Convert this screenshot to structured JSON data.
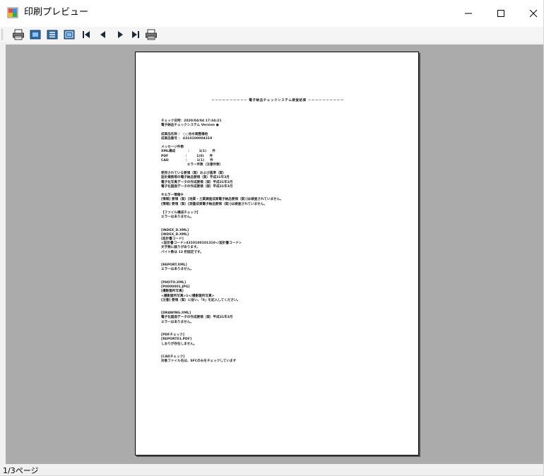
{
  "window": {
    "title": "印刷プレビュー"
  },
  "toolbar": {
    "buttons": [
      {
        "name": "print-icon"
      },
      {
        "name": "zoom-icon"
      },
      {
        "name": "one-page-icon"
      },
      {
        "name": "two-page-icon"
      },
      {
        "name": "first-page-icon"
      },
      {
        "name": "previous-page-icon"
      },
      {
        "name": "next-page-icon"
      },
      {
        "name": "last-page-icon"
      },
      {
        "name": "print-setup-icon"
      }
    ]
  },
  "document": {
    "title": "－－－－－－－－－－ 電子納品チェックシステム検査結果 －－－－－－－－－－",
    "lines": [
      "チェック日時：2020/04/04 17:34:21",
      "電子納品チェックシステム Version ●",
      "",
      "成果品名称 ： ○○谷水路整備他",
      "成果品番号 ： 4310100004310",
      "",
      "メッセージ件数",
      "XML構成           ：       1(1)     件",
      "PDF               ：       1(0)     件",
      "CAD               ：       1(1)     件",
      "                       エラー件数（注意件数）",
      "",
      "使用されている要領（案）および基準（案）",
      "設計業務等の電子納品要領（案）平成31年3月",
      "電子化写真データの作成要領（案）平成31年3月",
      "電子化図面データの作成要領（案）平成31年3月",
      "",
      "※エラー情報※",
      "[情報] 要領（案）[地質・土質調査成果電子納品要領（案）]は検査されていません。",
      "[情報] 要領（案）[測量成果電子納品要領（案）]は検査されていません。",
      "",
      "【ファイル構成チェック】",
      "エラーはありません。",
      "",
      "",
      "[INDEX_D.XML]",
      "[INDEX_D.XML]",
      "[設計書コード]",
      "<設計書コード>4310100101310</設計書コード>",
      "文字数に誤りがあります。",
      "バイト数は 13 桁固定です。",
      "",
      "",
      "[REPORT.XML]",
      "エラーはありません。",
      "",
      "",
      "[PHOTO.XML]",
      "[P0000001.JPG]",
      "[撮影箇所写真]",
      "<撮影箇所写真>1</撮影箇所写真>",
      "[注意] 要領（案）に従い、「0」を記入してください。",
      "",
      "",
      "[DRAWING.XML]",
      "電子化図面データの作成要領（案）平成31年3月",
      "エラーはありません。",
      "",
      "",
      "[PDFチェック]",
      "[REPORT01.PDF]",
      "しおりが存在しません。",
      "",
      "",
      "[CADチェック]",
      "対象ファイル名は、SFCのみをチェックしています"
    ]
  },
  "status": {
    "page_indicator": "1/3ページ"
  }
}
